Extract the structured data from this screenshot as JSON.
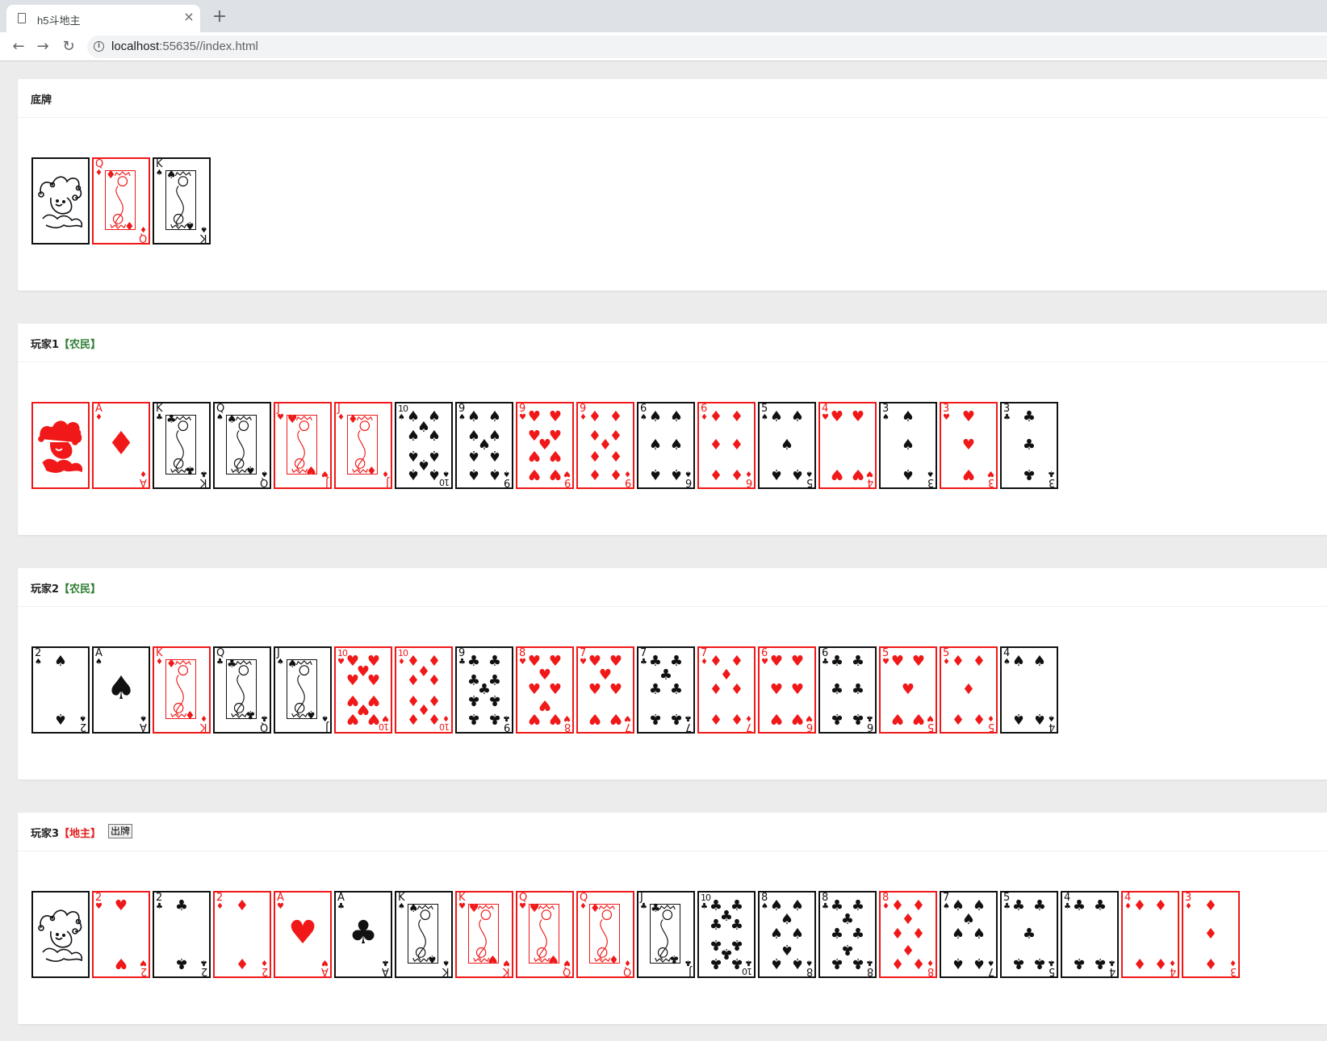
{
  "browser": {
    "tab_title": "h5斗地主",
    "close_glyph": "×",
    "new_tab_glyph": "+",
    "back_glyph": "←",
    "forward_glyph": "→",
    "reload_glyph": "↻",
    "info_glyph": "i",
    "url_host": "localhost",
    "url_port": ":55635",
    "url_path": "//index.html"
  },
  "colors": {
    "red_card": "#f01818",
    "black_card": "#111111",
    "farmer": "#2e7d32",
    "landlord": "#e41e1e"
  },
  "panels": [
    {
      "id": "bottom",
      "title": "底牌",
      "role": "",
      "role_type": "",
      "button": "",
      "cards": [
        {
          "rank": "JOKER",
          "suit": "joker",
          "color": "black"
        },
        {
          "rank": "Q",
          "suit": "diamonds",
          "color": "red"
        },
        {
          "rank": "K",
          "suit": "spades",
          "color": "black"
        }
      ]
    },
    {
      "id": "player1",
      "title": "玩家1",
      "role": "【农民】",
      "role_type": "farmer",
      "button": "",
      "cards": [
        {
          "rank": "JOKER",
          "suit": "joker",
          "color": "red"
        },
        {
          "rank": "A",
          "suit": "diamonds",
          "color": "red"
        },
        {
          "rank": "K",
          "suit": "clubs",
          "color": "black"
        },
        {
          "rank": "Q",
          "suit": "spades",
          "color": "black"
        },
        {
          "rank": "J",
          "suit": "hearts",
          "color": "red"
        },
        {
          "rank": "J",
          "suit": "diamonds",
          "color": "red"
        },
        {
          "rank": "10",
          "suit": "spades",
          "color": "black"
        },
        {
          "rank": "9",
          "suit": "spades",
          "color": "black"
        },
        {
          "rank": "9",
          "suit": "hearts",
          "color": "red"
        },
        {
          "rank": "9",
          "suit": "diamonds",
          "color": "red"
        },
        {
          "rank": "6",
          "suit": "spades",
          "color": "black"
        },
        {
          "rank": "6",
          "suit": "diamonds",
          "color": "red"
        },
        {
          "rank": "5",
          "suit": "spades",
          "color": "black"
        },
        {
          "rank": "4",
          "suit": "hearts",
          "color": "red"
        },
        {
          "rank": "3",
          "suit": "spades",
          "color": "black"
        },
        {
          "rank": "3",
          "suit": "hearts",
          "color": "red"
        },
        {
          "rank": "3",
          "suit": "clubs",
          "color": "black"
        }
      ]
    },
    {
      "id": "player2",
      "title": "玩家2",
      "role": "【农民】",
      "role_type": "farmer",
      "button": "",
      "cards": [
        {
          "rank": "2",
          "suit": "spades",
          "color": "black"
        },
        {
          "rank": "A",
          "suit": "spades",
          "color": "black"
        },
        {
          "rank": "K",
          "suit": "diamonds",
          "color": "red"
        },
        {
          "rank": "Q",
          "suit": "clubs",
          "color": "black"
        },
        {
          "rank": "J",
          "suit": "spades",
          "color": "black"
        },
        {
          "rank": "10",
          "suit": "hearts",
          "color": "red"
        },
        {
          "rank": "10",
          "suit": "diamonds",
          "color": "red"
        },
        {
          "rank": "9",
          "suit": "clubs",
          "color": "black"
        },
        {
          "rank": "8",
          "suit": "hearts",
          "color": "red"
        },
        {
          "rank": "7",
          "suit": "hearts",
          "color": "red"
        },
        {
          "rank": "7",
          "suit": "clubs",
          "color": "black"
        },
        {
          "rank": "7",
          "suit": "diamonds",
          "color": "red"
        },
        {
          "rank": "6",
          "suit": "hearts",
          "color": "red"
        },
        {
          "rank": "6",
          "suit": "clubs",
          "color": "black"
        },
        {
          "rank": "5",
          "suit": "hearts",
          "color": "red"
        },
        {
          "rank": "5",
          "suit": "diamonds",
          "color": "red"
        },
        {
          "rank": "4",
          "suit": "spades",
          "color": "black"
        }
      ]
    },
    {
      "id": "player3",
      "title": "玩家3",
      "role": "【地主】",
      "role_type": "landlord",
      "button": "出牌",
      "cards": [
        {
          "rank": "JOKER",
          "suit": "joker",
          "color": "black"
        },
        {
          "rank": "2",
          "suit": "hearts",
          "color": "red"
        },
        {
          "rank": "2",
          "suit": "clubs",
          "color": "black"
        },
        {
          "rank": "2",
          "suit": "diamonds",
          "color": "red"
        },
        {
          "rank": "A",
          "suit": "hearts",
          "color": "red"
        },
        {
          "rank": "A",
          "suit": "clubs",
          "color": "black"
        },
        {
          "rank": "K",
          "suit": "spades",
          "color": "black"
        },
        {
          "rank": "K",
          "suit": "hearts",
          "color": "red"
        },
        {
          "rank": "Q",
          "suit": "hearts",
          "color": "red"
        },
        {
          "rank": "Q",
          "suit": "diamonds",
          "color": "red"
        },
        {
          "rank": "J",
          "suit": "clubs",
          "color": "black"
        },
        {
          "rank": "10",
          "suit": "clubs",
          "color": "black"
        },
        {
          "rank": "8",
          "suit": "spades",
          "color": "black"
        },
        {
          "rank": "8",
          "suit": "clubs",
          "color": "black"
        },
        {
          "rank": "8",
          "suit": "diamonds",
          "color": "red"
        },
        {
          "rank": "7",
          "suit": "spades",
          "color": "black"
        },
        {
          "rank": "5",
          "suit": "clubs",
          "color": "black"
        },
        {
          "rank": "4",
          "suit": "clubs",
          "color": "black"
        },
        {
          "rank": "4",
          "suit": "diamonds",
          "color": "red"
        },
        {
          "rank": "3",
          "suit": "diamonds",
          "color": "red"
        }
      ]
    }
  ]
}
